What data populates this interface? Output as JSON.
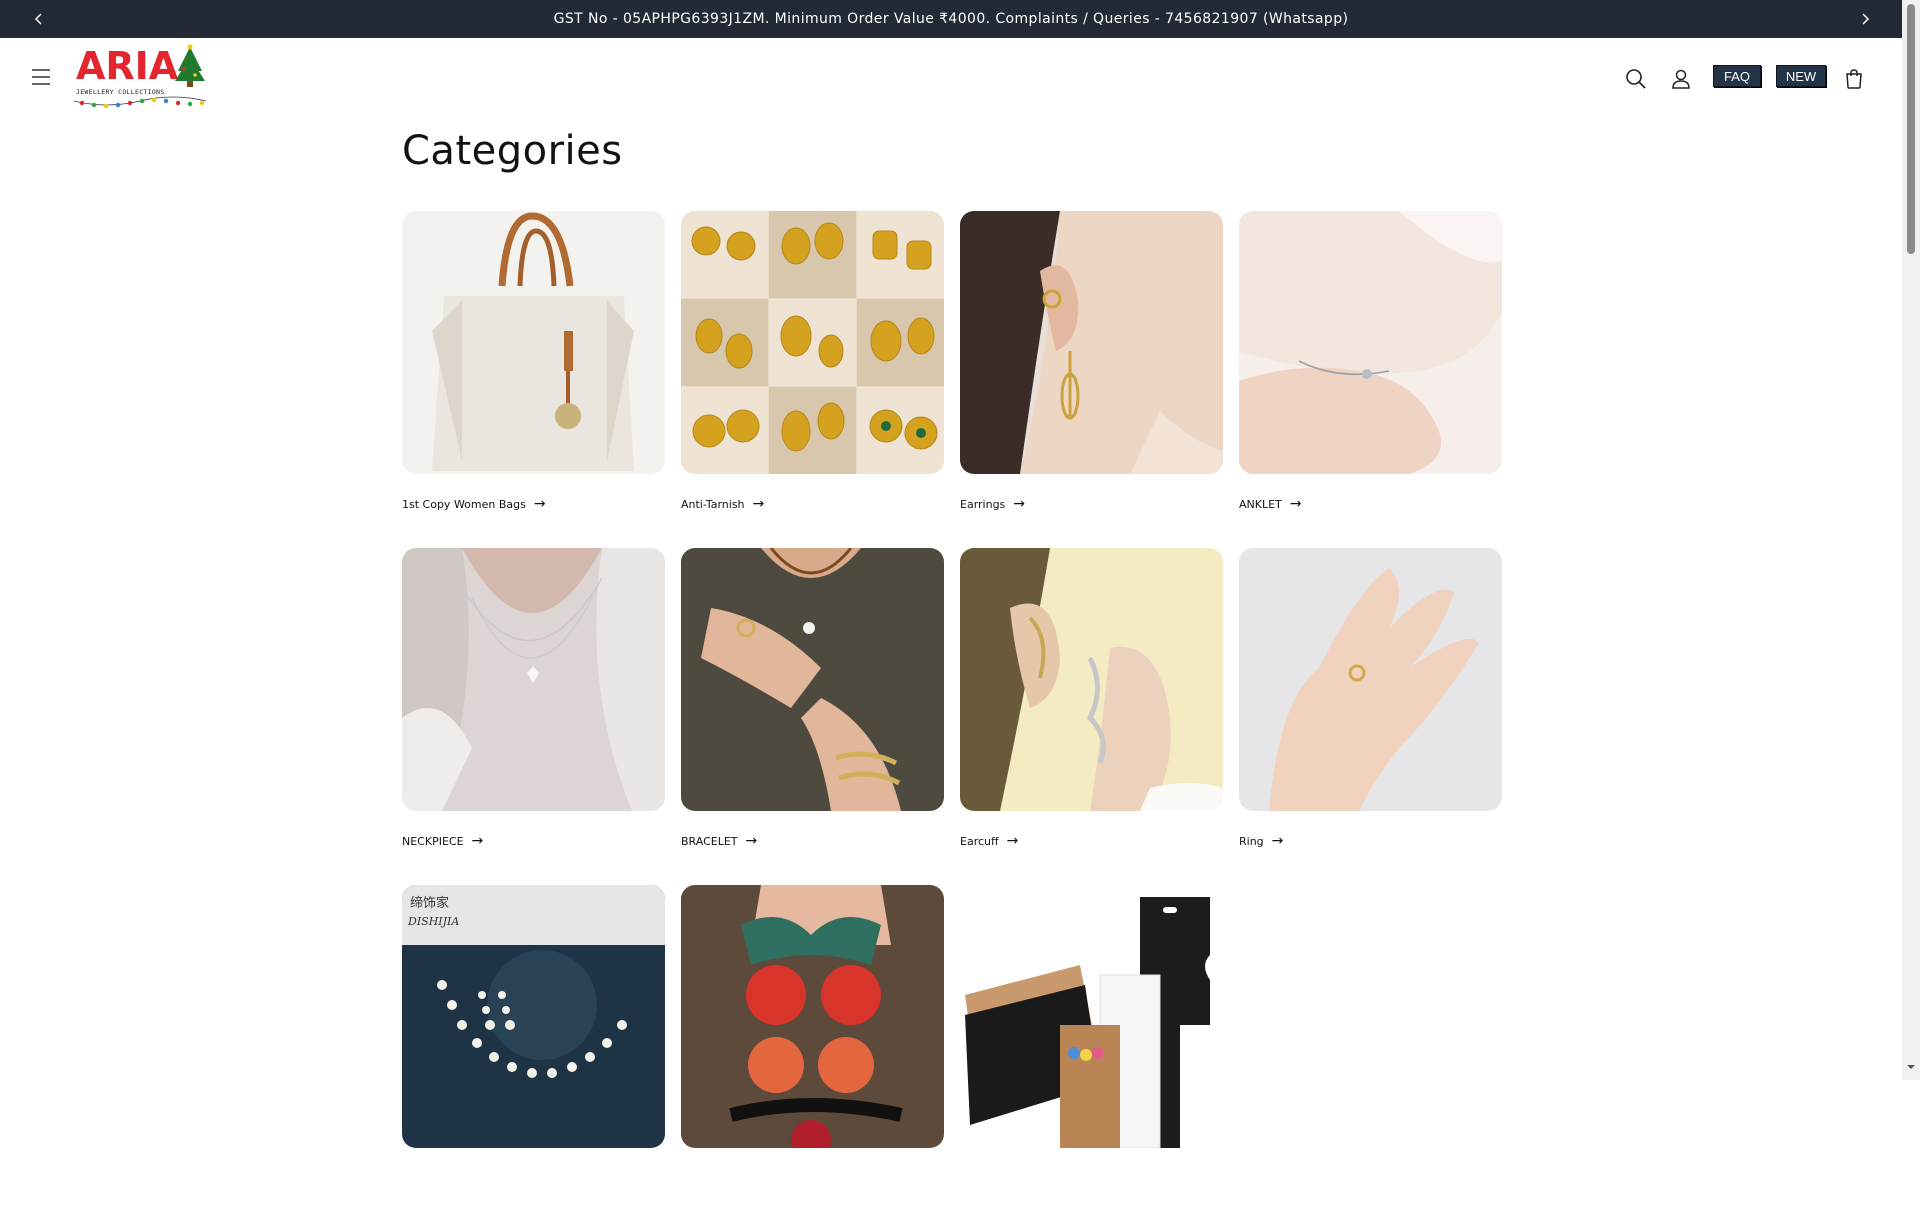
{
  "announcement": {
    "text": "GST No - 05APHPG6393J1ZM. Minimum Order Value ₹4000. Complaints / Queries - 7456821907 (Whatsapp)"
  },
  "header": {
    "logo_text": "ARIA",
    "logo_subtext": "JEWELLERY COLLECTIONS",
    "faq_label": "FAQ",
    "new_label": "NEW"
  },
  "main": {
    "title": "Categories",
    "categories": [
      {
        "label": "1st Copy Women Bags",
        "icon": "handbag-image"
      },
      {
        "label": "Anti-Tarnish",
        "icon": "gold-earrings-grid-image"
      },
      {
        "label": "Earrings",
        "icon": "ear-earring-image"
      },
      {
        "label": "ANKLET",
        "icon": "ankle-chain-image"
      },
      {
        "label": "NECKPIECE",
        "icon": "necklace-image"
      },
      {
        "label": "BRACELET",
        "icon": "bracelet-image"
      },
      {
        "label": "Earcuff",
        "icon": "earcuff-image"
      },
      {
        "label": "Ring",
        "icon": "ring-image"
      },
      {
        "label": "",
        "icon": "pearl-necklace-set-image"
      },
      {
        "label": "",
        "icon": "hair-ties-image"
      },
      {
        "label": "",
        "icon": "display-cards-image"
      }
    ]
  },
  "colors": {
    "announcement_bg": "#232a35",
    "button_bg": "#243447",
    "logo_red": "#e3262e"
  }
}
